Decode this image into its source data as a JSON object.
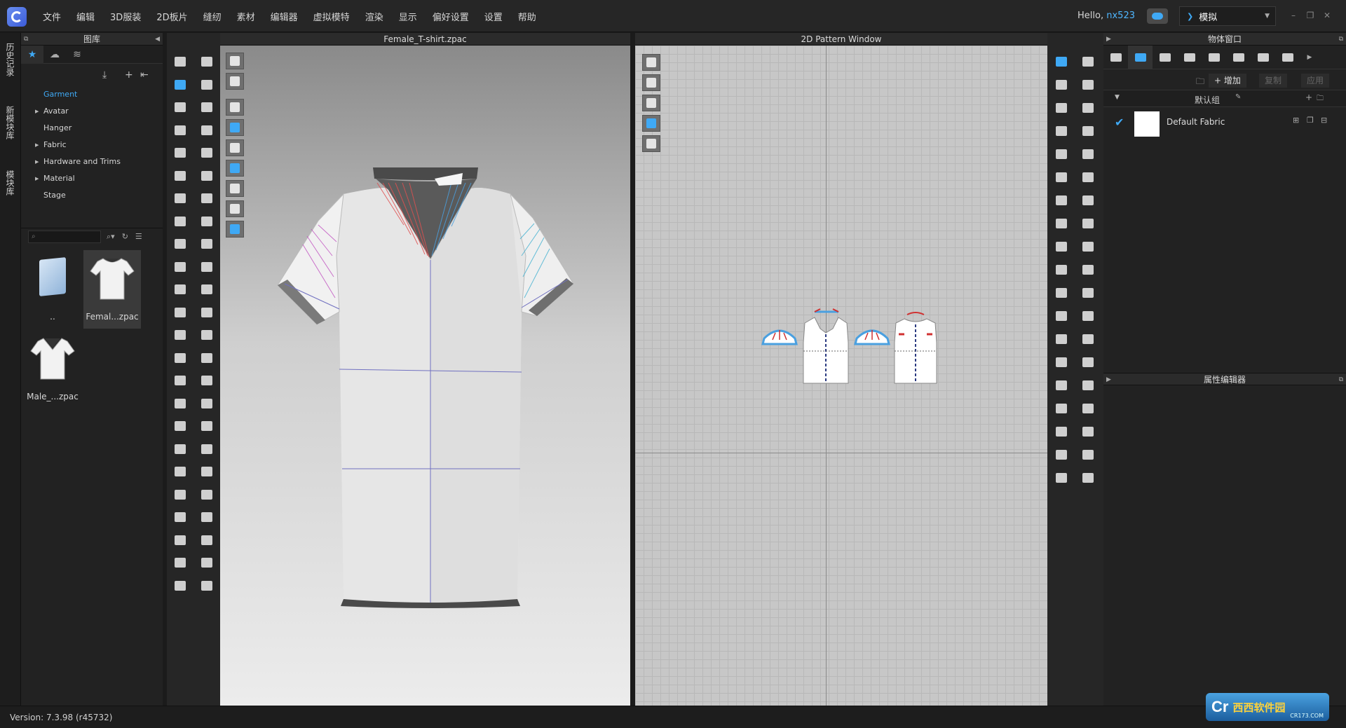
{
  "menubar": {
    "items": [
      "文件",
      "编辑",
      "3D服装",
      "2D板片",
      "缝纫",
      "素材",
      "编辑器",
      "虚拟模特",
      "渲染",
      "显示",
      "偏好设置",
      "设置",
      "帮助"
    ],
    "hello_prefix": "Hello,",
    "username": "nx523",
    "mode_label": "模拟"
  },
  "left_strip": {
    "tabs": [
      "历史记录",
      "新模块库",
      "模块库"
    ]
  },
  "library": {
    "title": "图库",
    "tree": [
      {
        "label": "Garment",
        "expandable": false,
        "active": true
      },
      {
        "label": "Avatar",
        "expandable": true,
        "active": false
      },
      {
        "label": "Hanger",
        "expandable": false,
        "active": false
      },
      {
        "label": "Fabric",
        "expandable": true,
        "active": false
      },
      {
        "label": "Hardware and Trims",
        "expandable": true,
        "active": false
      },
      {
        "label": "Material",
        "expandable": true,
        "active": false
      },
      {
        "label": "Stage",
        "expandable": false,
        "active": false
      }
    ],
    "thumbnails": [
      {
        "label": ".."
      },
      {
        "label": "Femal...zpac"
      },
      {
        "label": "Male_...zpac"
      }
    ]
  },
  "view3d": {
    "title": "Female_T-shirt.zpac"
  },
  "view2d": {
    "title": "2D Pattern Window"
  },
  "object_panel": {
    "title": "物体窗口",
    "add_label": "增加",
    "copy_label": "复制",
    "apply_label": "应用",
    "group_label": "默认组",
    "fabric_name": "Default Fabric"
  },
  "attribute_panel": {
    "title": "属性编辑器"
  },
  "status": {
    "version": "Version: 7.3.98 (r45732)"
  },
  "watermark": {
    "logo_text": "Cr",
    "cn_text": "西西软件园",
    "url": "CR173.COM"
  },
  "colors": {
    "accent": "#3fa9f5",
    "background": "#1b1b1b",
    "panel": "#222222"
  }
}
